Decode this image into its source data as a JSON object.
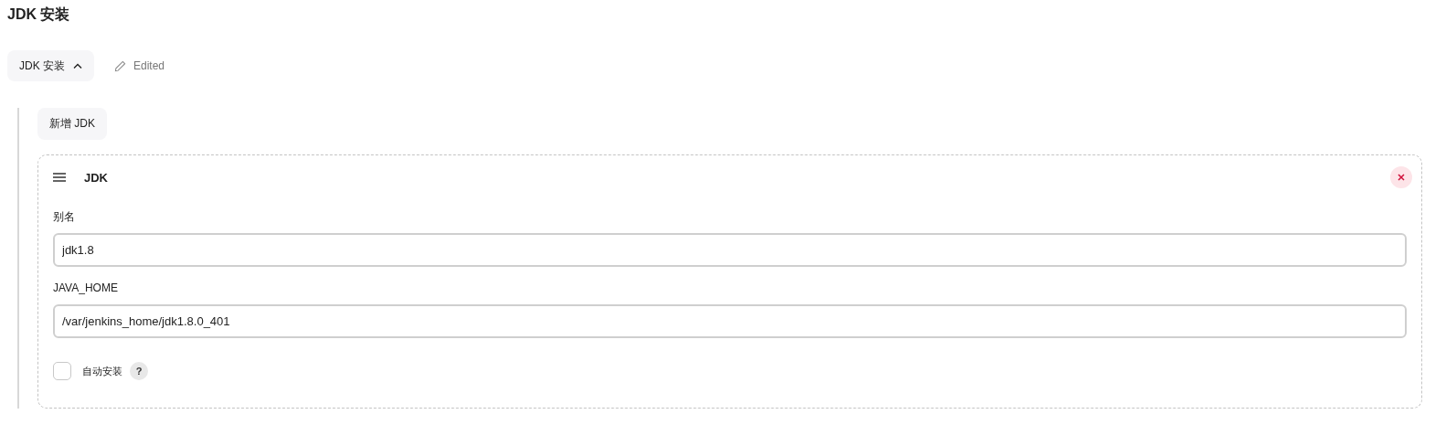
{
  "title": "JDK 安装",
  "section_toggle": {
    "label": "JDK 安装",
    "expanded": true
  },
  "status": "Edited",
  "add_button": "新增 JDK",
  "card": {
    "title": "JDK",
    "fields": [
      {
        "label": "别名",
        "value": "jdk1.8"
      },
      {
        "label": "JAVA_HOME",
        "value": "/var/jenkins_home/jdk1.8.0_401"
      }
    ],
    "checkbox": {
      "label": "自动安装",
      "checked": false,
      "help": "?"
    }
  }
}
